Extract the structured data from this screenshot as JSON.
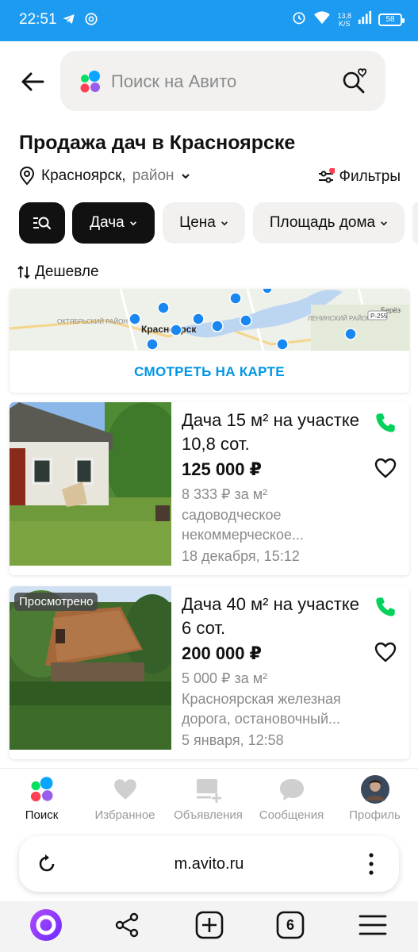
{
  "status_bar": {
    "time": "22:51",
    "speed_value": "13,8",
    "speed_unit": "K/S",
    "battery": "58",
    "left_icons": [
      "telegram-icon",
      "at-icon"
    ],
    "right_icons": [
      "alarm-icon",
      "wifi-icon",
      "signal-icon",
      "battery-icon"
    ]
  },
  "header": {
    "back_icon": "arrow-left-icon",
    "search_placeholder": "Поиск на Авито",
    "saved_search_icon": "search-heart-icon"
  },
  "page": {
    "title": "Продажа дач в Красноярске",
    "location_city": "Красноярск,",
    "location_area": "район",
    "filters_label": "Фильтры",
    "sort_label": "Дешевле"
  },
  "chips": [
    {
      "label": "",
      "icon": "search-filter-icon",
      "dark": true
    },
    {
      "label": "Дача",
      "dark": true
    },
    {
      "label": "Цена",
      "dark": false
    },
    {
      "label": "Площадь дома",
      "dark": false
    }
  ],
  "map": {
    "labels": [
      "ОКТЯБРЬСКИЙ РАЙОН",
      "Красноярск",
      "ЛЕНИНСКИЙ РАЙОН",
      "Берёз",
      "Р-255"
    ],
    "button_label": "СМОТРЕТЬ НА КАРТЕ"
  },
  "listings": [
    {
      "title": "Дача 15 м² на участке 10,8 сот.",
      "price": "125 000 ₽",
      "price_per_m": "8 333 ₽ за м²",
      "address": "садоводческое некоммерческое...",
      "date": "18 декабря, 15:12",
      "viewed": ""
    },
    {
      "title": "Дача 40 м² на участке 6 сот.",
      "price": "200 000 ₽",
      "price_per_m": "5 000 ₽ за м²",
      "address": "Красноярская железная дорога, остановочный...",
      "date": "5 января, 12:58",
      "viewed": "Просмотрено"
    }
  ],
  "tabbar": [
    {
      "label": "Поиск",
      "icon": "avito-dots-icon",
      "active": true
    },
    {
      "label": "Избранное",
      "icon": "heart-icon",
      "active": false
    },
    {
      "label": "Объявления",
      "icon": "ads-add-icon",
      "active": false
    },
    {
      "label": "Сообщения",
      "icon": "chat-icon",
      "active": false
    },
    {
      "label": "Профиль",
      "icon": "avatar-icon",
      "active": false
    }
  ],
  "browser": {
    "url": "m.avito.ru",
    "tab_count": "6",
    "nav_icons": [
      "alice-icon",
      "share-icon",
      "new-tab-icon",
      "tabs-icon",
      "menu-icon"
    ]
  },
  "colors": {
    "accent_blue": "#0096e6",
    "status_bar": "#1d9bf0",
    "phone_green": "#02d15c",
    "chip_dark": "#111111",
    "chip_light": "#f2f1f0"
  }
}
